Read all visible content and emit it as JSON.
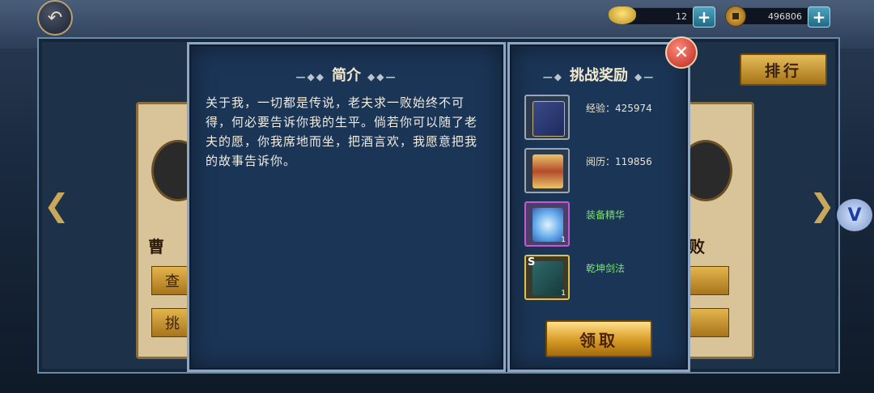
{
  "top_bar": {
    "gold_ingot": "12",
    "copper_coins": "496806",
    "back_icon": "back-arrow-icon",
    "plus_icon": "plus-icon"
  },
  "side": {
    "rank_label": "排行",
    "left_arrow": "❮",
    "right_arrow": "❯",
    "vip_icon": "V"
  },
  "cards": {
    "left_name": "曹",
    "left_btn1": "查",
    "left_btn2": "挑",
    "right_name": "败"
  },
  "intro": {
    "title": "简介",
    "text": "关于我，一切都是传说，老夫求一败始终不可得，何必要告诉你我的生平。倘若你可以随了老夫的愿，你我席地而坐，把酒言欢，我愿意把我的故事告诉你。"
  },
  "reward": {
    "title": "挑战奖励",
    "items": [
      {
        "label": "经验：425974",
        "icon": "exp-book-icon",
        "color": "#e9e3d0",
        "badge": ""
      },
      {
        "label": "阅历：119856",
        "icon": "scroll-icon",
        "color": "#e9e3d0",
        "badge": ""
      },
      {
        "label": "装备精华",
        "icon": "crystal-icon",
        "color": "#7fe07a",
        "badge": "1"
      },
      {
        "label": "乾坤剑法",
        "icon": "skill-manual-icon",
        "color": "#7fe07a",
        "badge": "1"
      }
    ],
    "claim_label": "领取",
    "close_icon": "✕"
  },
  "colors": {
    "accent_gold": "#d79a25",
    "reward_green": "#7fe07a",
    "panel_blue": "#1b3556"
  }
}
